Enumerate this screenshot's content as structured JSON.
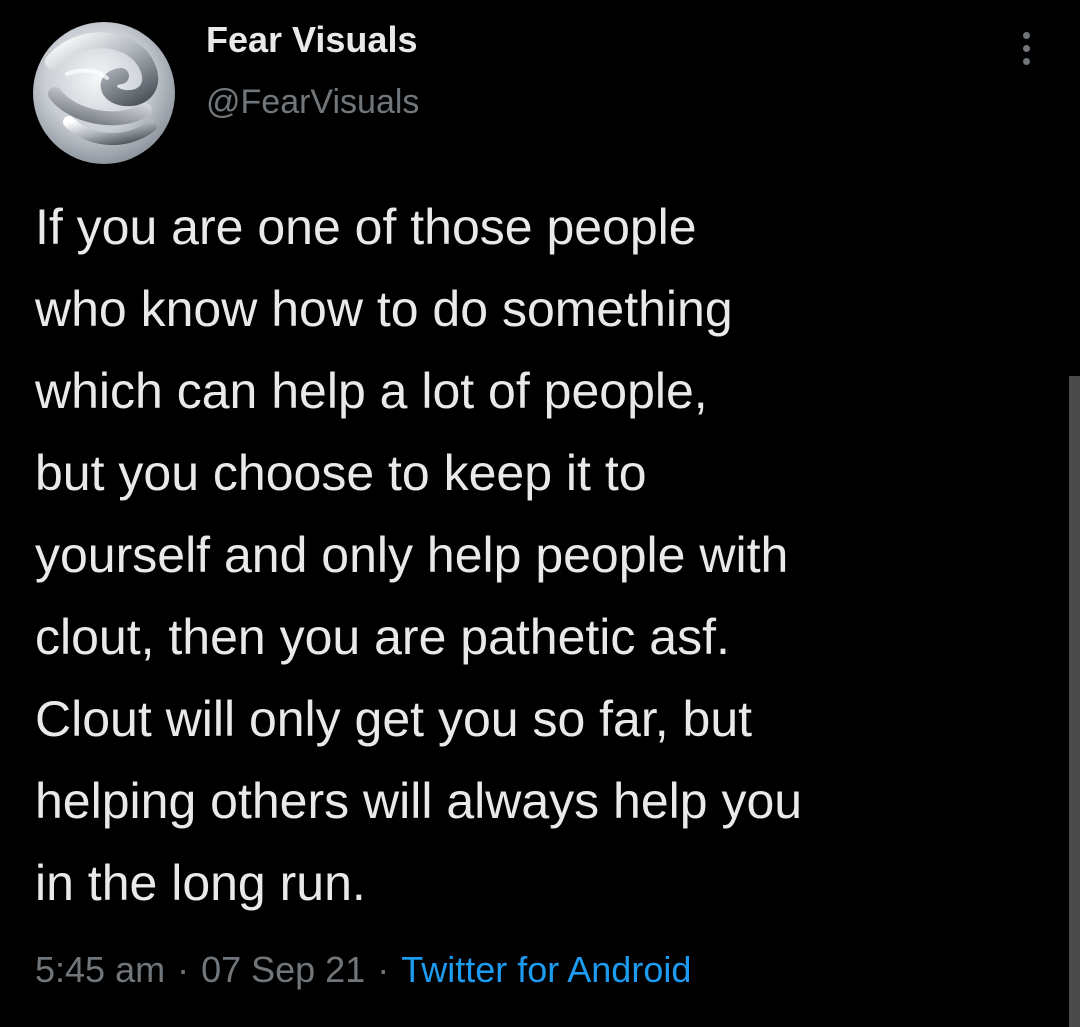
{
  "author": {
    "display_name": "Fear Visuals",
    "handle": "@FearVisuals",
    "avatar_icon": "chrome-swirl-avatar"
  },
  "menu": {
    "icon": "more-vertical-icon"
  },
  "tweet": {
    "lines": [
      "If you are one of those people",
      "who know how to do something",
      "which can help a lot of people,",
      "but you choose to keep it to",
      "yourself and only help people with",
      "clout, then you are pathetic asf.",
      "Clout will only get you so far, but",
      "helping others will always help you",
      "in the long run."
    ]
  },
  "meta": {
    "time": "5:45 am",
    "separator": "·",
    "date": "07 Sep 21",
    "source": "Twitter for Android"
  },
  "colors": {
    "background": "#000000",
    "text_primary": "#e7e9ea",
    "text_secondary": "#71767b",
    "link": "#1d9bf0"
  }
}
